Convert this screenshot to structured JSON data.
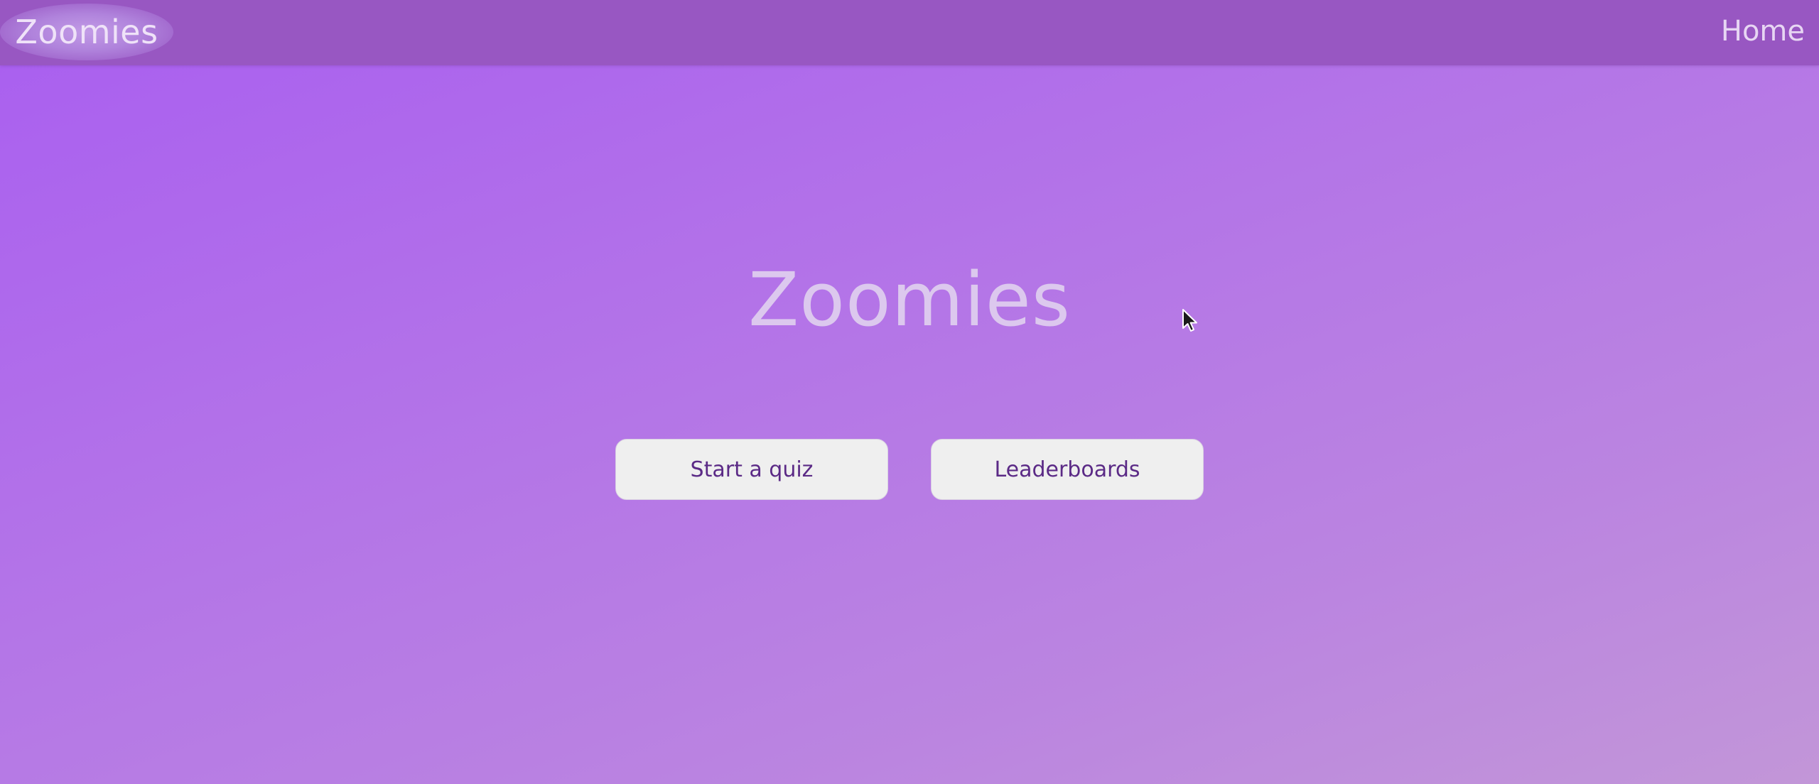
{
  "navbar": {
    "brand": "Zoomies",
    "home": "Home"
  },
  "hero": {
    "title": "Zoomies",
    "start_quiz": "Start a quiz",
    "leaderboards": "Leaderboards"
  },
  "colors": {
    "navbar_bg": "#9857c2",
    "gradient_start": "#a95ef0",
    "gradient_end": "#c296d8",
    "button_bg": "#efefef",
    "button_text": "#5b2a86",
    "title_text": "#dcc8ee"
  },
  "icons": {
    "cursor": "mouse-pointer-icon"
  }
}
